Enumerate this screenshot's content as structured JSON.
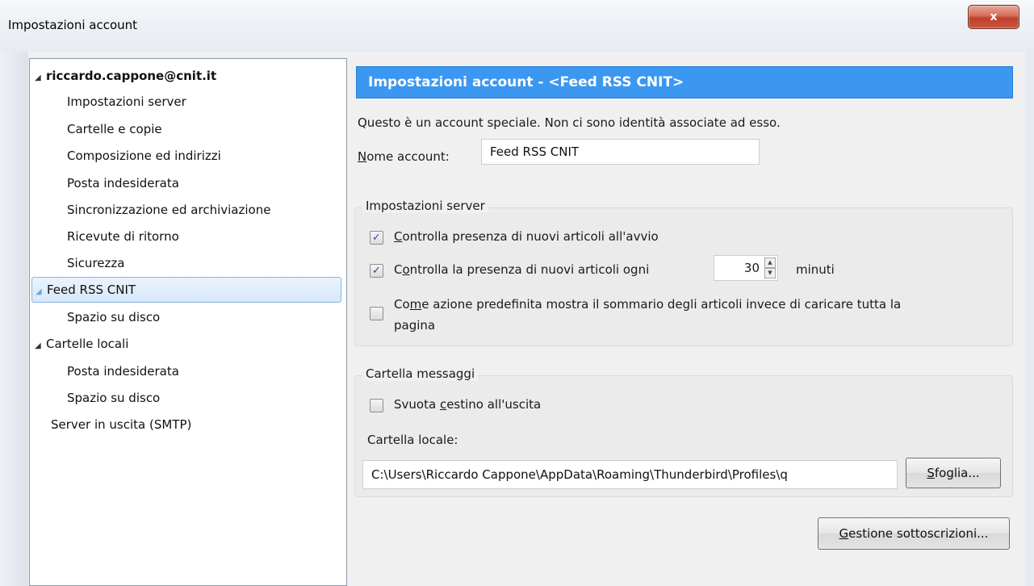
{
  "window": {
    "title": "Impostazioni account",
    "close_glyph": "x"
  },
  "tree": {
    "items": [
      {
        "label": "riccardo.cappone@cnit.it",
        "level": 0,
        "expanded": true
      },
      {
        "label": "Impostazioni server",
        "level": 1
      },
      {
        "label": "Cartelle e copie",
        "level": 1
      },
      {
        "label": "Composizione ed indirizzi",
        "level": 1
      },
      {
        "label": "Posta indesiderata",
        "level": 1
      },
      {
        "label": "Sincronizzazione ed archiviazione",
        "level": 1
      },
      {
        "label": "Ricevute di ritorno",
        "level": 1
      },
      {
        "label": "Sicurezza",
        "level": 1
      },
      {
        "label": "Feed RSS CNIT",
        "level": 0,
        "expanded": true,
        "selected": true
      },
      {
        "label": "Spazio su disco",
        "level": 1
      },
      {
        "label": "Cartelle locali",
        "level": 0,
        "expanded": true
      },
      {
        "label": "Posta indesiderata",
        "level": 1
      },
      {
        "label": "Spazio su disco",
        "level": 1
      },
      {
        "label": "Server in uscita (SMTP)",
        "level": 0
      }
    ],
    "twisty_glyph": "◢"
  },
  "main": {
    "header": "Impostazioni account - <Feed RSS CNIT>",
    "info": "Questo è un account speciale. Non ci sono identità associate ad esso.",
    "account_name": {
      "label_accel": "N",
      "label_rest": "ome account:",
      "value": "Feed RSS CNIT"
    },
    "server_settings": {
      "legend": "Impostazioni server",
      "check_on_startup": {
        "accel": "C",
        "rest": "ontrolla presenza di nuovi articoli all'avvio",
        "checked": true
      },
      "check_every": {
        "pre": "C",
        "accel": "o",
        "rest": "ntrolla la presenza di nuovi articoli ogni",
        "checked": true,
        "minutes": "30",
        "unit": "minuti"
      },
      "show_summary": {
        "pre": "Co",
        "accel": "m",
        "rest_line1": "e azione predefinita mostra il sommario degli articoli invece di caricare tutta la",
        "line2": "pagina",
        "checked": false
      }
    },
    "message_folder": {
      "legend": "Cartella messaggi",
      "empty_trash": {
        "pre": "Svuota ",
        "accel": "c",
        "rest": "estino all'uscita",
        "checked": false
      },
      "local_folder_label": "Cartella locale:",
      "local_folder_path": "C:\\Users\\Riccardo Cappone\\AppData\\Roaming\\Thunderbird\\Profiles\\q",
      "browse_accel": "S",
      "browse_rest": "foglia..."
    },
    "manage_subscriptions": {
      "accel": "G",
      "rest": "estione sottoscrizioni..."
    },
    "check_glyph": "✓",
    "spin_up_glyph": "▲",
    "spin_down_glyph": "▼"
  }
}
